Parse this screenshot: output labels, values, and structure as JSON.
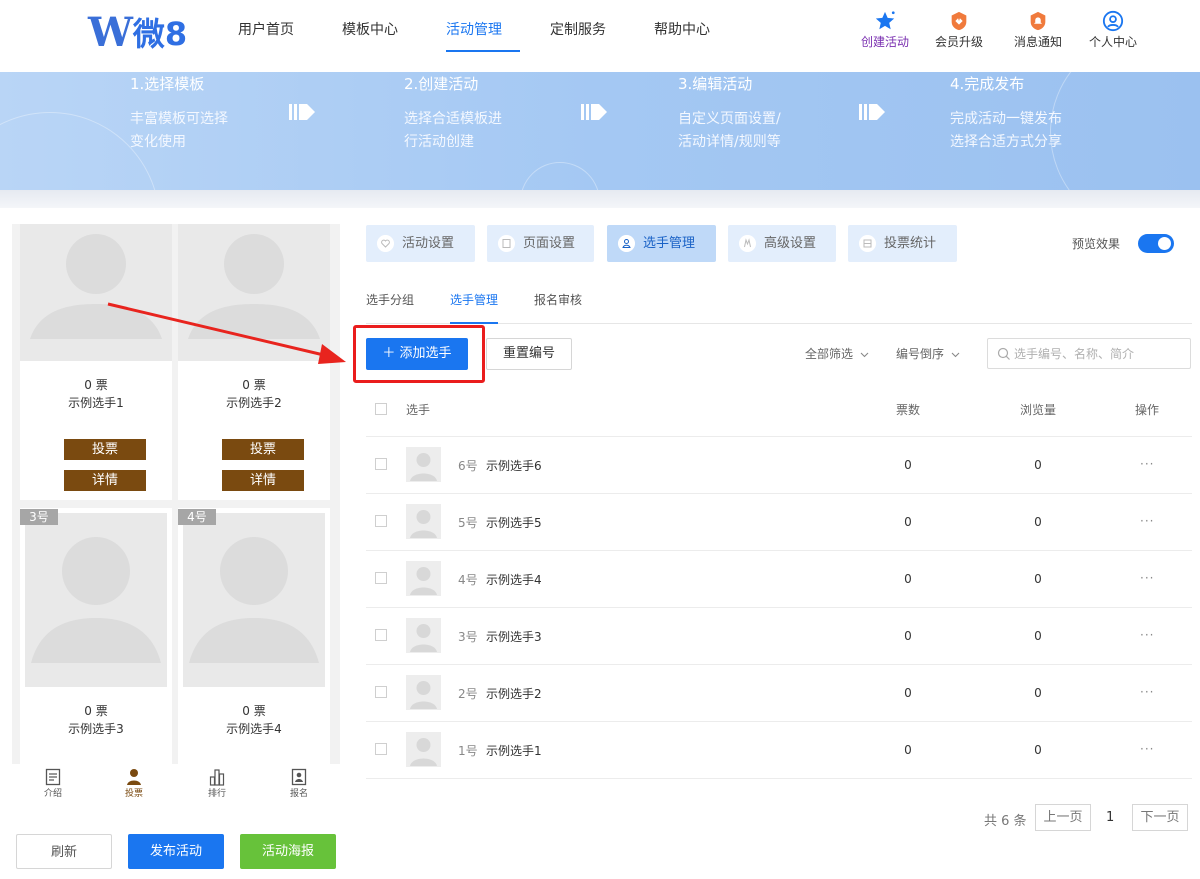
{
  "header": {
    "logo_text": "W微8",
    "logo_w": "W",
    "logo_rest": "微8",
    "nav": [
      {
        "label": "用户首页"
      },
      {
        "label": "模板中心"
      },
      {
        "label": "活动管理"
      },
      {
        "label": "定制服务"
      },
      {
        "label": "帮助中心"
      }
    ],
    "active_nav": "活动管理",
    "icons": [
      {
        "label": "创建活动",
        "icon": "star-icon",
        "color": "#1a76f0"
      },
      {
        "label": "会员升级",
        "icon": "badge-icon",
        "color": "#f07a3c"
      },
      {
        "label": "消息通知",
        "icon": "bell-icon",
        "color": "#f07a3c"
      },
      {
        "label": "个人中心",
        "icon": "user-circle-icon",
        "color": "#1a76f0"
      }
    ]
  },
  "banner": {
    "steps": [
      {
        "title": "1.选择模板",
        "desc1": "丰富模板可选择",
        "desc2": "变化使用"
      },
      {
        "title": "2.创建活动",
        "desc1": "选择合适模板进",
        "desc2": "行活动创建"
      },
      {
        "title": "3.编辑活动",
        "desc1": "自定义页面设置/",
        "desc2": "活动详情/规则等"
      },
      {
        "title": "4.完成发布",
        "desc1": "完成活动一键发布",
        "desc2": "选择合适方式分享"
      }
    ]
  },
  "preview": {
    "cards": [
      {
        "votes": "0 票",
        "name": "示例选手1",
        "badge": "",
        "vote_btn": "投票",
        "detail_btn": "详情"
      },
      {
        "votes": "0 票",
        "name": "示例选手2",
        "badge": "",
        "vote_btn": "投票",
        "detail_btn": "详情"
      },
      {
        "votes": "0 票",
        "name": "示例选手3",
        "badge": "3号"
      },
      {
        "votes": "0 票",
        "name": "示例选手4",
        "badge": "4号"
      }
    ],
    "bottom_tabs": [
      {
        "label": "介绍",
        "icon": "document-icon"
      },
      {
        "label": "投票",
        "icon": "person-icon"
      },
      {
        "label": "排行",
        "icon": "bar-chart-icon"
      },
      {
        "label": "报名",
        "icon": "id-card-icon"
      }
    ],
    "active_tab": "投票",
    "accent_color": "#7a4a10"
  },
  "actions": {
    "refresh": "刷新",
    "publish": "发布活动",
    "poster": "活动海报"
  },
  "settings_tabs": [
    {
      "label": "活动设置",
      "icon": "heart-icon"
    },
    {
      "label": "页面设置",
      "icon": "page-icon"
    },
    {
      "label": "选手管理",
      "icon": "contestant-icon"
    },
    {
      "label": "高级设置",
      "icon": "advanced-icon"
    },
    {
      "label": "投票统计",
      "icon": "stats-icon"
    }
  ],
  "active_settings_tab": "选手管理",
  "preview_toggle": {
    "label": "预览效果",
    "on": true
  },
  "sub_tabs": [
    {
      "label": "选手分组"
    },
    {
      "label": "选手管理"
    },
    {
      "label": "报名审核"
    }
  ],
  "active_sub_tab": "选手管理",
  "toolbar": {
    "add_label": "＋ 添加选手",
    "renumber_label": "重置编号",
    "filter_all": "全部筛选",
    "sort_label": "编号倒序",
    "search_placeholder": "选手编号、名称、简介"
  },
  "table": {
    "headers": {
      "contestant": "选手",
      "votes": "票数",
      "views": "浏览量",
      "ops": "操作"
    },
    "rows": [
      {
        "num": "6号",
        "name": "示例选手6",
        "votes": "0",
        "views": "0"
      },
      {
        "num": "5号",
        "name": "示例选手5",
        "votes": "0",
        "views": "0"
      },
      {
        "num": "4号",
        "name": "示例选手4",
        "votes": "0",
        "views": "0"
      },
      {
        "num": "3号",
        "name": "示例选手3",
        "votes": "0",
        "views": "0"
      },
      {
        "num": "2号",
        "name": "示例选手2",
        "votes": "0",
        "views": "0"
      },
      {
        "num": "1号",
        "name": "示例选手1",
        "votes": "0",
        "views": "0"
      }
    ],
    "more": "···"
  },
  "pagination": {
    "total": "共 6 条",
    "prev": "上一页",
    "current": "1",
    "next": "下一页"
  },
  "colors": {
    "primary": "#1a76f0",
    "highlight_box": "#ea1d1d",
    "publish_btn": "#1a76f0",
    "poster_btn": "#67c23a"
  }
}
